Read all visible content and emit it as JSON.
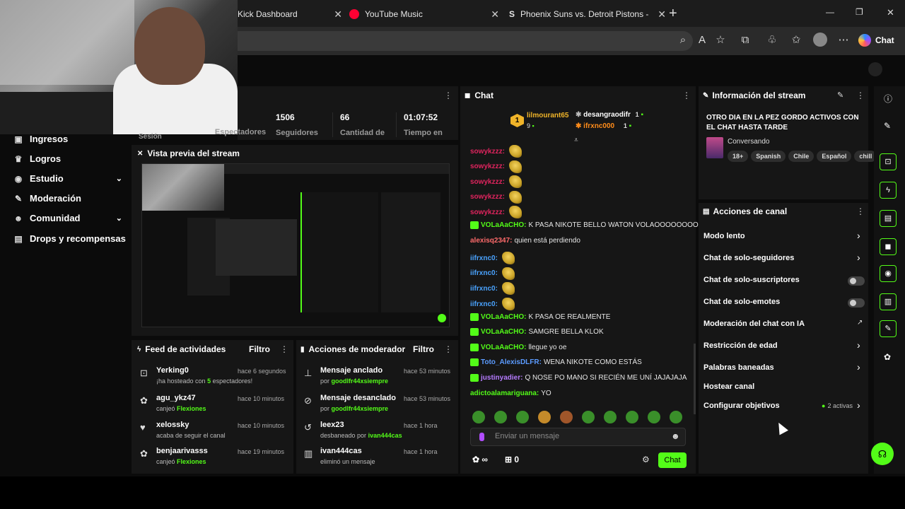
{
  "browser": {
    "tabs": [
      {
        "title": "Kick Dashboard"
      },
      {
        "title": "YouTube Music"
      },
      {
        "title": "Phoenix Suns vs. Detroit Pistons -"
      }
    ],
    "new_tab": "+",
    "copilot_label": "Chat",
    "window_controls": [
      "—",
      "❐",
      "✕"
    ]
  },
  "sidebar": {
    "session_label": "Sesión",
    "items": [
      {
        "label": "Ingresos",
        "icon": "wallet-icon"
      },
      {
        "label": "Logros",
        "icon": "trophy-icon"
      },
      {
        "label": "Estudio",
        "icon": "camera-icon",
        "expandable": true
      },
      {
        "label": "Moderación",
        "icon": "wrench-icon"
      },
      {
        "label": "Comunidad",
        "icon": "people-icon",
        "expandable": true
      },
      {
        "label": "Drops y recompensas",
        "icon": "gift-icon"
      }
    ]
  },
  "stats": [
    {
      "value": "",
      "label": "Espectadores"
    },
    {
      "value": "1506",
      "label": "Seguidores"
    },
    {
      "value": "66",
      "label": "Cantidad de"
    },
    {
      "value": "01:07:52",
      "label": "Tiempo en"
    }
  ],
  "preview": {
    "title": "Vista previa del stream"
  },
  "activity_feed": {
    "title": "Feed de actividades",
    "filter": "Filtro",
    "items": [
      {
        "name": "Yerking0",
        "time": "hace 6 segundos",
        "sub_pre": "¡ha hosteado con ",
        "sub_hl": "5",
        "sub_post": " espectadores!",
        "icon": "host-icon"
      },
      {
        "name": "agu_ykz47",
        "time": "hace 10 minutos",
        "sub_pre": "canjeó ",
        "sub_hl": "Flexiones",
        "sub_post": "",
        "icon": "redeem-icon"
      },
      {
        "name": "xelossky",
        "time": "hace 10 minutos",
        "sub_pre": "acaba de seguir el canal",
        "sub_hl": "",
        "sub_post": "",
        "icon": "heart-icon"
      },
      {
        "name": "benjaarivasss",
        "time": "hace 19 minutos",
        "sub_pre": "canjeó ",
        "sub_hl": "Flexiones",
        "sub_post": "",
        "icon": "redeem-icon"
      }
    ]
  },
  "mod_actions": {
    "title": "Acciones de moderador",
    "filter": "Filtro",
    "items": [
      {
        "name": "Mensaje anclado",
        "time": "hace 53 minutos",
        "sub_pre": "por ",
        "sub_hl": "goodlfr44xsiempre",
        "icon": "pin-icon"
      },
      {
        "name": "Mensaje desanclado",
        "time": "hace 53 minutos",
        "sub_pre": "por ",
        "sub_hl": "goodlfr44xsiempre",
        "icon": "unpin-icon"
      },
      {
        "name": "leex23",
        "time": "hace 1 hora",
        "sub_pre": "desbaneado por ",
        "sub_hl": "ivan444cas",
        "icon": "undo-icon"
      },
      {
        "name": "ivan444cas",
        "time": "hace 1 hora",
        "sub_pre": "eliminó un mensaje",
        "sub_hl": "",
        "icon": "trash-icon"
      }
    ]
  },
  "chat": {
    "title": "Chat",
    "leaderboard": [
      {
        "rank": "1",
        "name": "lilmourant65",
        "count": "9"
      },
      {
        "name": "desangraodifr",
        "count": "1"
      },
      {
        "name": "ifrxnc000",
        "count": "1"
      }
    ],
    "messages": [
      {
        "user": "sowykzzz:",
        "text": "",
        "color": "#e0245e",
        "emote": true,
        "badge": false
      },
      {
        "user": "sowykzzz:",
        "text": "",
        "color": "#e0245e",
        "emote": true,
        "badge": false
      },
      {
        "user": "sowykzzz:",
        "text": "",
        "color": "#e0245e",
        "emote": true,
        "badge": false
      },
      {
        "user": "sowykzzz:",
        "text": "",
        "color": "#e0245e",
        "emote": true,
        "badge": false
      },
      {
        "user": "sowykzzz:",
        "text": "",
        "color": "#e0245e",
        "emote": true,
        "badge": false
      },
      {
        "user": "VOLaAaCHO:",
        "text": "K PASA NIKOTE BELLO WATON VOLAOOOOOOOO",
        "color": "#53fc18",
        "emote": false,
        "badge": true
      },
      {
        "user": "alexisq2347:",
        "text": "quien está perdiendo",
        "color": "#ff6b6b",
        "emote": false,
        "badge": false
      },
      {
        "user": "iifrxnc0:",
        "text": "",
        "color": "#4aa3ff",
        "emote": true,
        "badge": false
      },
      {
        "user": "iifrxnc0:",
        "text": "",
        "color": "#4aa3ff",
        "emote": true,
        "badge": false
      },
      {
        "user": "iifrxnc0:",
        "text": "",
        "color": "#4aa3ff",
        "emote": true,
        "badge": false
      },
      {
        "user": "iifrxnc0:",
        "text": "",
        "color": "#4aa3ff",
        "emote": true,
        "badge": false
      },
      {
        "user": "VOLaAaCHO:",
        "text": "K PASA OE REALMENTE",
        "color": "#53fc18",
        "emote": false,
        "badge": true
      },
      {
        "user": "VOLaAaCHO:",
        "text": "SAMGRE BELLA KLOK",
        "color": "#53fc18",
        "emote": false,
        "badge": true
      },
      {
        "user": "VOLaAaCHO:",
        "text": "llegue yo oe",
        "color": "#53fc18",
        "emote": false,
        "badge": true
      },
      {
        "user": "Toto_AlexisDLFR:",
        "text": "WENA NIKOTE COMO ESTÁS",
        "color": "#5b9bff",
        "emote": false,
        "badge": true
      },
      {
        "user": "justinyadier:",
        "text": "Q NOSE PO MANO SI RECIÉN ME UNÍ JAJAJAJA",
        "color": "#b57bff",
        "emote": false,
        "badge": true
      },
      {
        "user": "adictoalamariguana:",
        "text": "YO",
        "color": "#53fc18",
        "emote": false,
        "badge": false
      }
    ],
    "input_placeholder": "Enviar un mensaje",
    "points": "∞",
    "gift_count": "0",
    "send_label": "Chat"
  },
  "stream_info": {
    "title": "Información del stream",
    "stream_title": "OTRO DIA EN LA PEZ GORDO ACTIVOS CON EL CHAT HASTA TARDE",
    "category": "Conversando",
    "tags": [
      "18+",
      "Spanish",
      "Chile",
      "Español",
      "chill"
    ]
  },
  "channel_actions": {
    "title": "Acciones de canal",
    "items": [
      {
        "label": "Modo lento",
        "kind": "chevron"
      },
      {
        "label": "Chat de solo-seguidores",
        "kind": "chevron"
      },
      {
        "label": "Chat de solo-suscriptores",
        "kind": "toggle"
      },
      {
        "label": "Chat de solo-emotes",
        "kind": "toggle"
      },
      {
        "label": "Moderación del chat con IA",
        "kind": "external"
      },
      {
        "label": "Restricción de edad",
        "kind": "chevron"
      },
      {
        "label": "Palabras baneadas",
        "kind": "chevron"
      },
      {
        "label": "Hostear canal",
        "kind": "none"
      },
      {
        "label": "Configurar objetivos",
        "kind": "goals"
      }
    ],
    "goals_active": "2 activas"
  },
  "colors": {
    "accent": "#53fc18",
    "panel": "#161616",
    "bg": "#0b0b0b"
  }
}
